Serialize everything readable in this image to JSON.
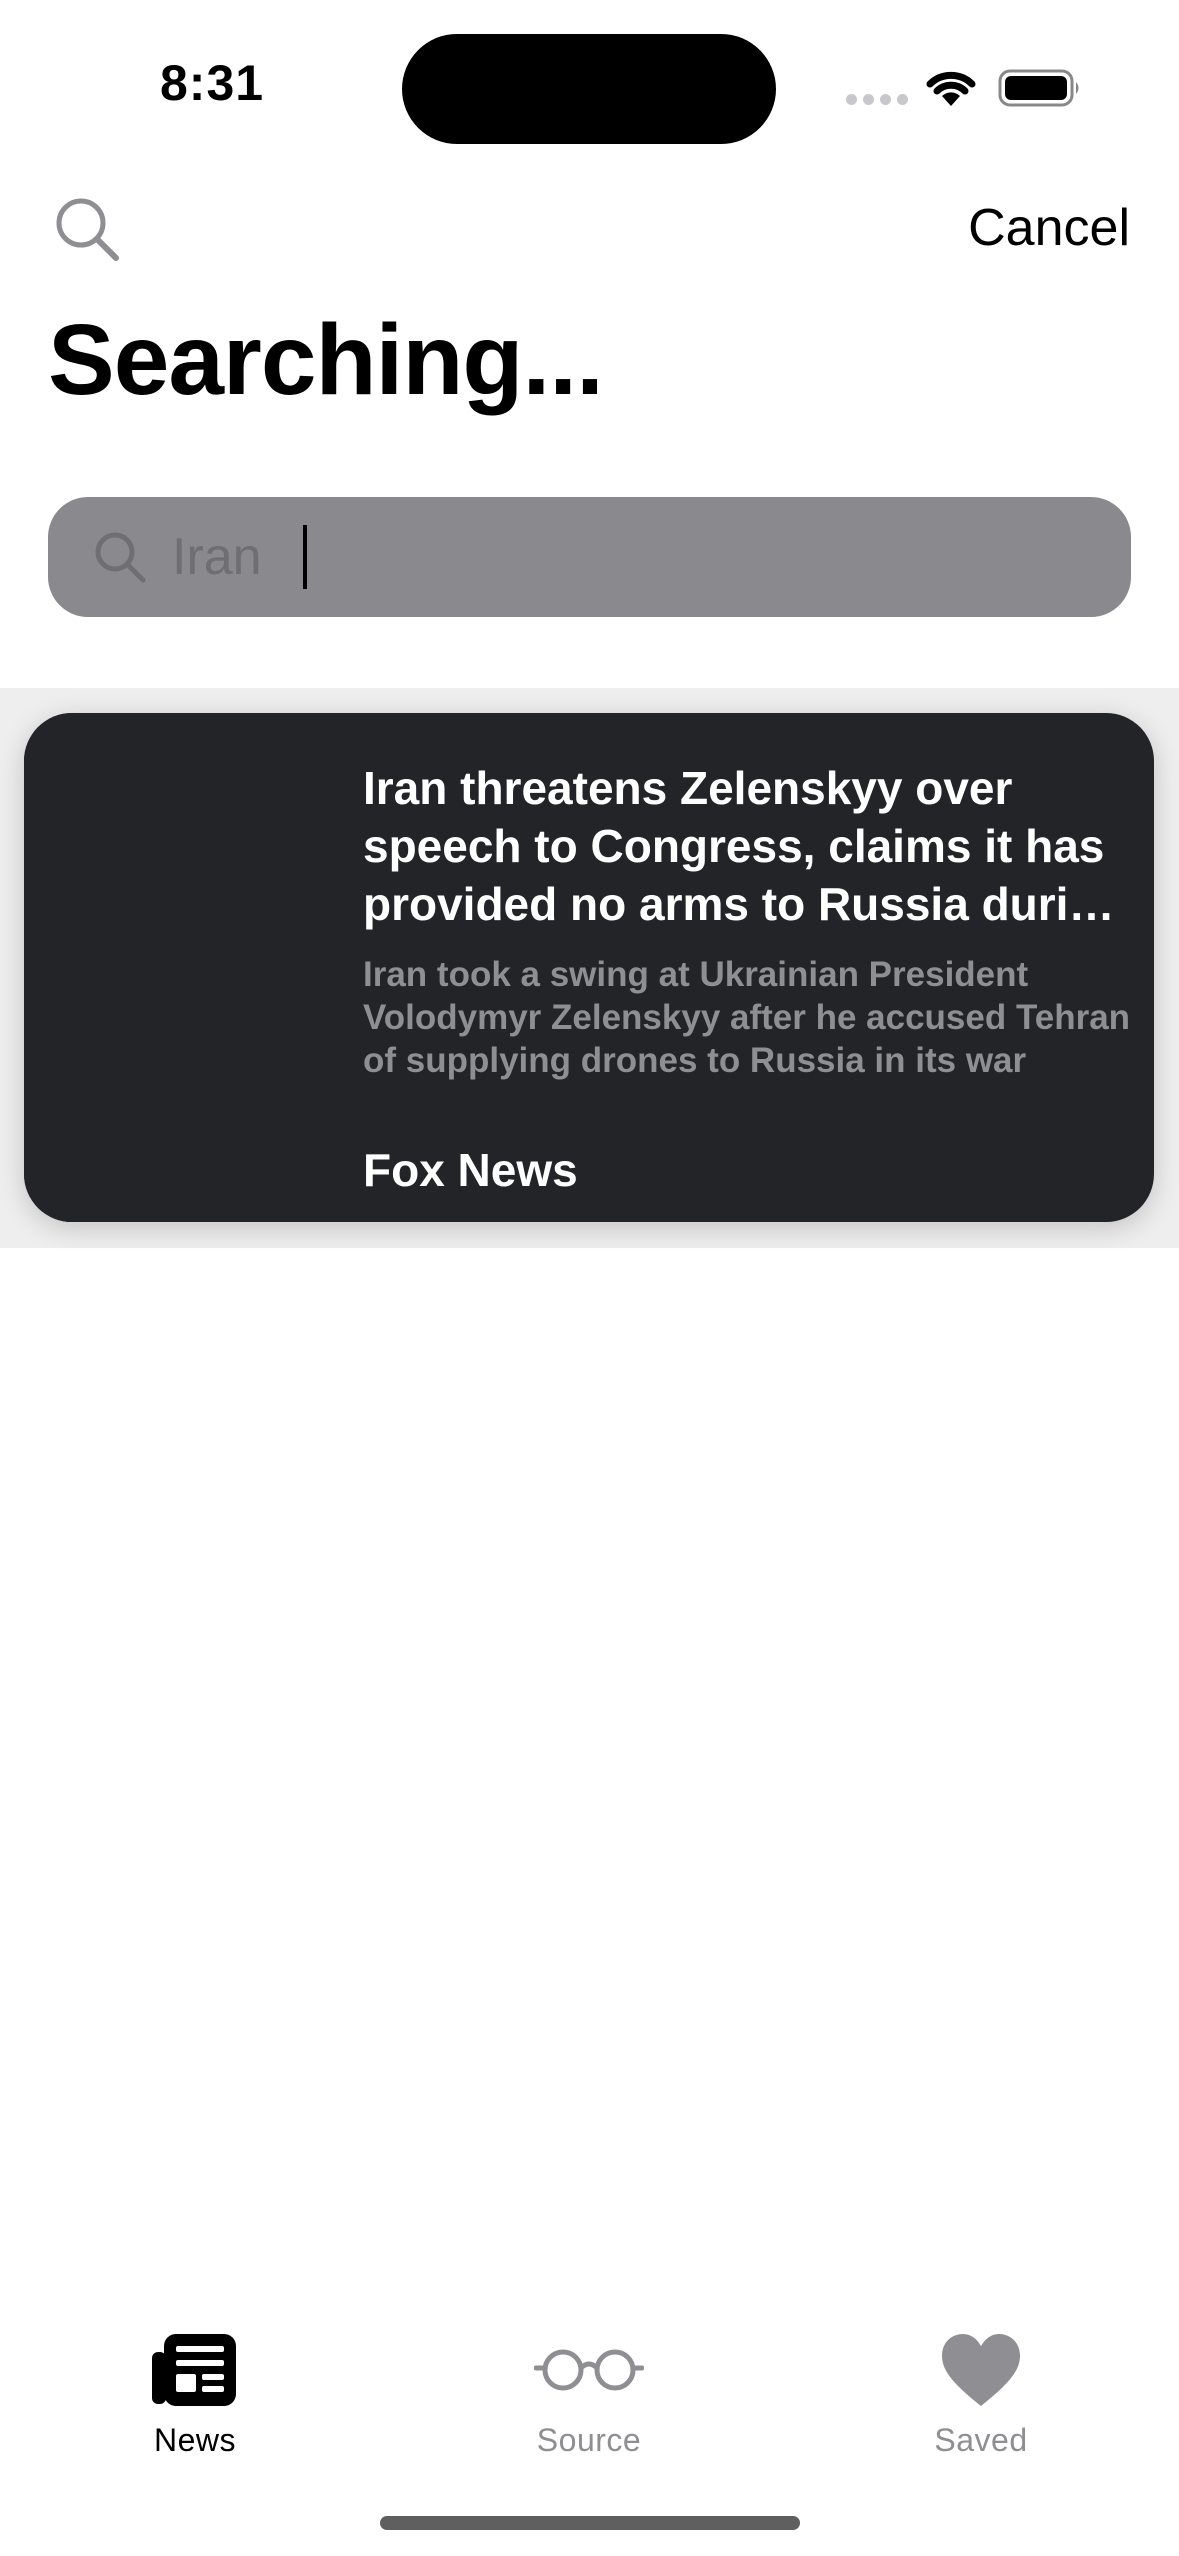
{
  "status_bar": {
    "time": "8:31"
  },
  "header": {
    "cancel_label": "Cancel",
    "title": "Searching..."
  },
  "search": {
    "value": "Iran"
  },
  "results": [
    {
      "headline": "Iran threatens Zelenskyy over speech to Congress, claims it has provided no arms to Russia during war",
      "summary": "Iran took a swing at Ukrainian President Volodymyr Zelenskyy after he accused Tehran of supplying drones to Russia in its war",
      "source": "Fox News"
    }
  ],
  "tab_bar": {
    "tabs": [
      {
        "label": "News",
        "icon": "newspaper-icon",
        "active": true
      },
      {
        "label": "Source",
        "icon": "glasses-icon",
        "active": false
      },
      {
        "label": "Saved",
        "icon": "heart-icon",
        "active": false
      }
    ]
  },
  "colors": {
    "card_background": "#222427",
    "search_field": "#8a8a8e",
    "inactive_tab": "#8e8e93",
    "active_tab": "#000000"
  }
}
